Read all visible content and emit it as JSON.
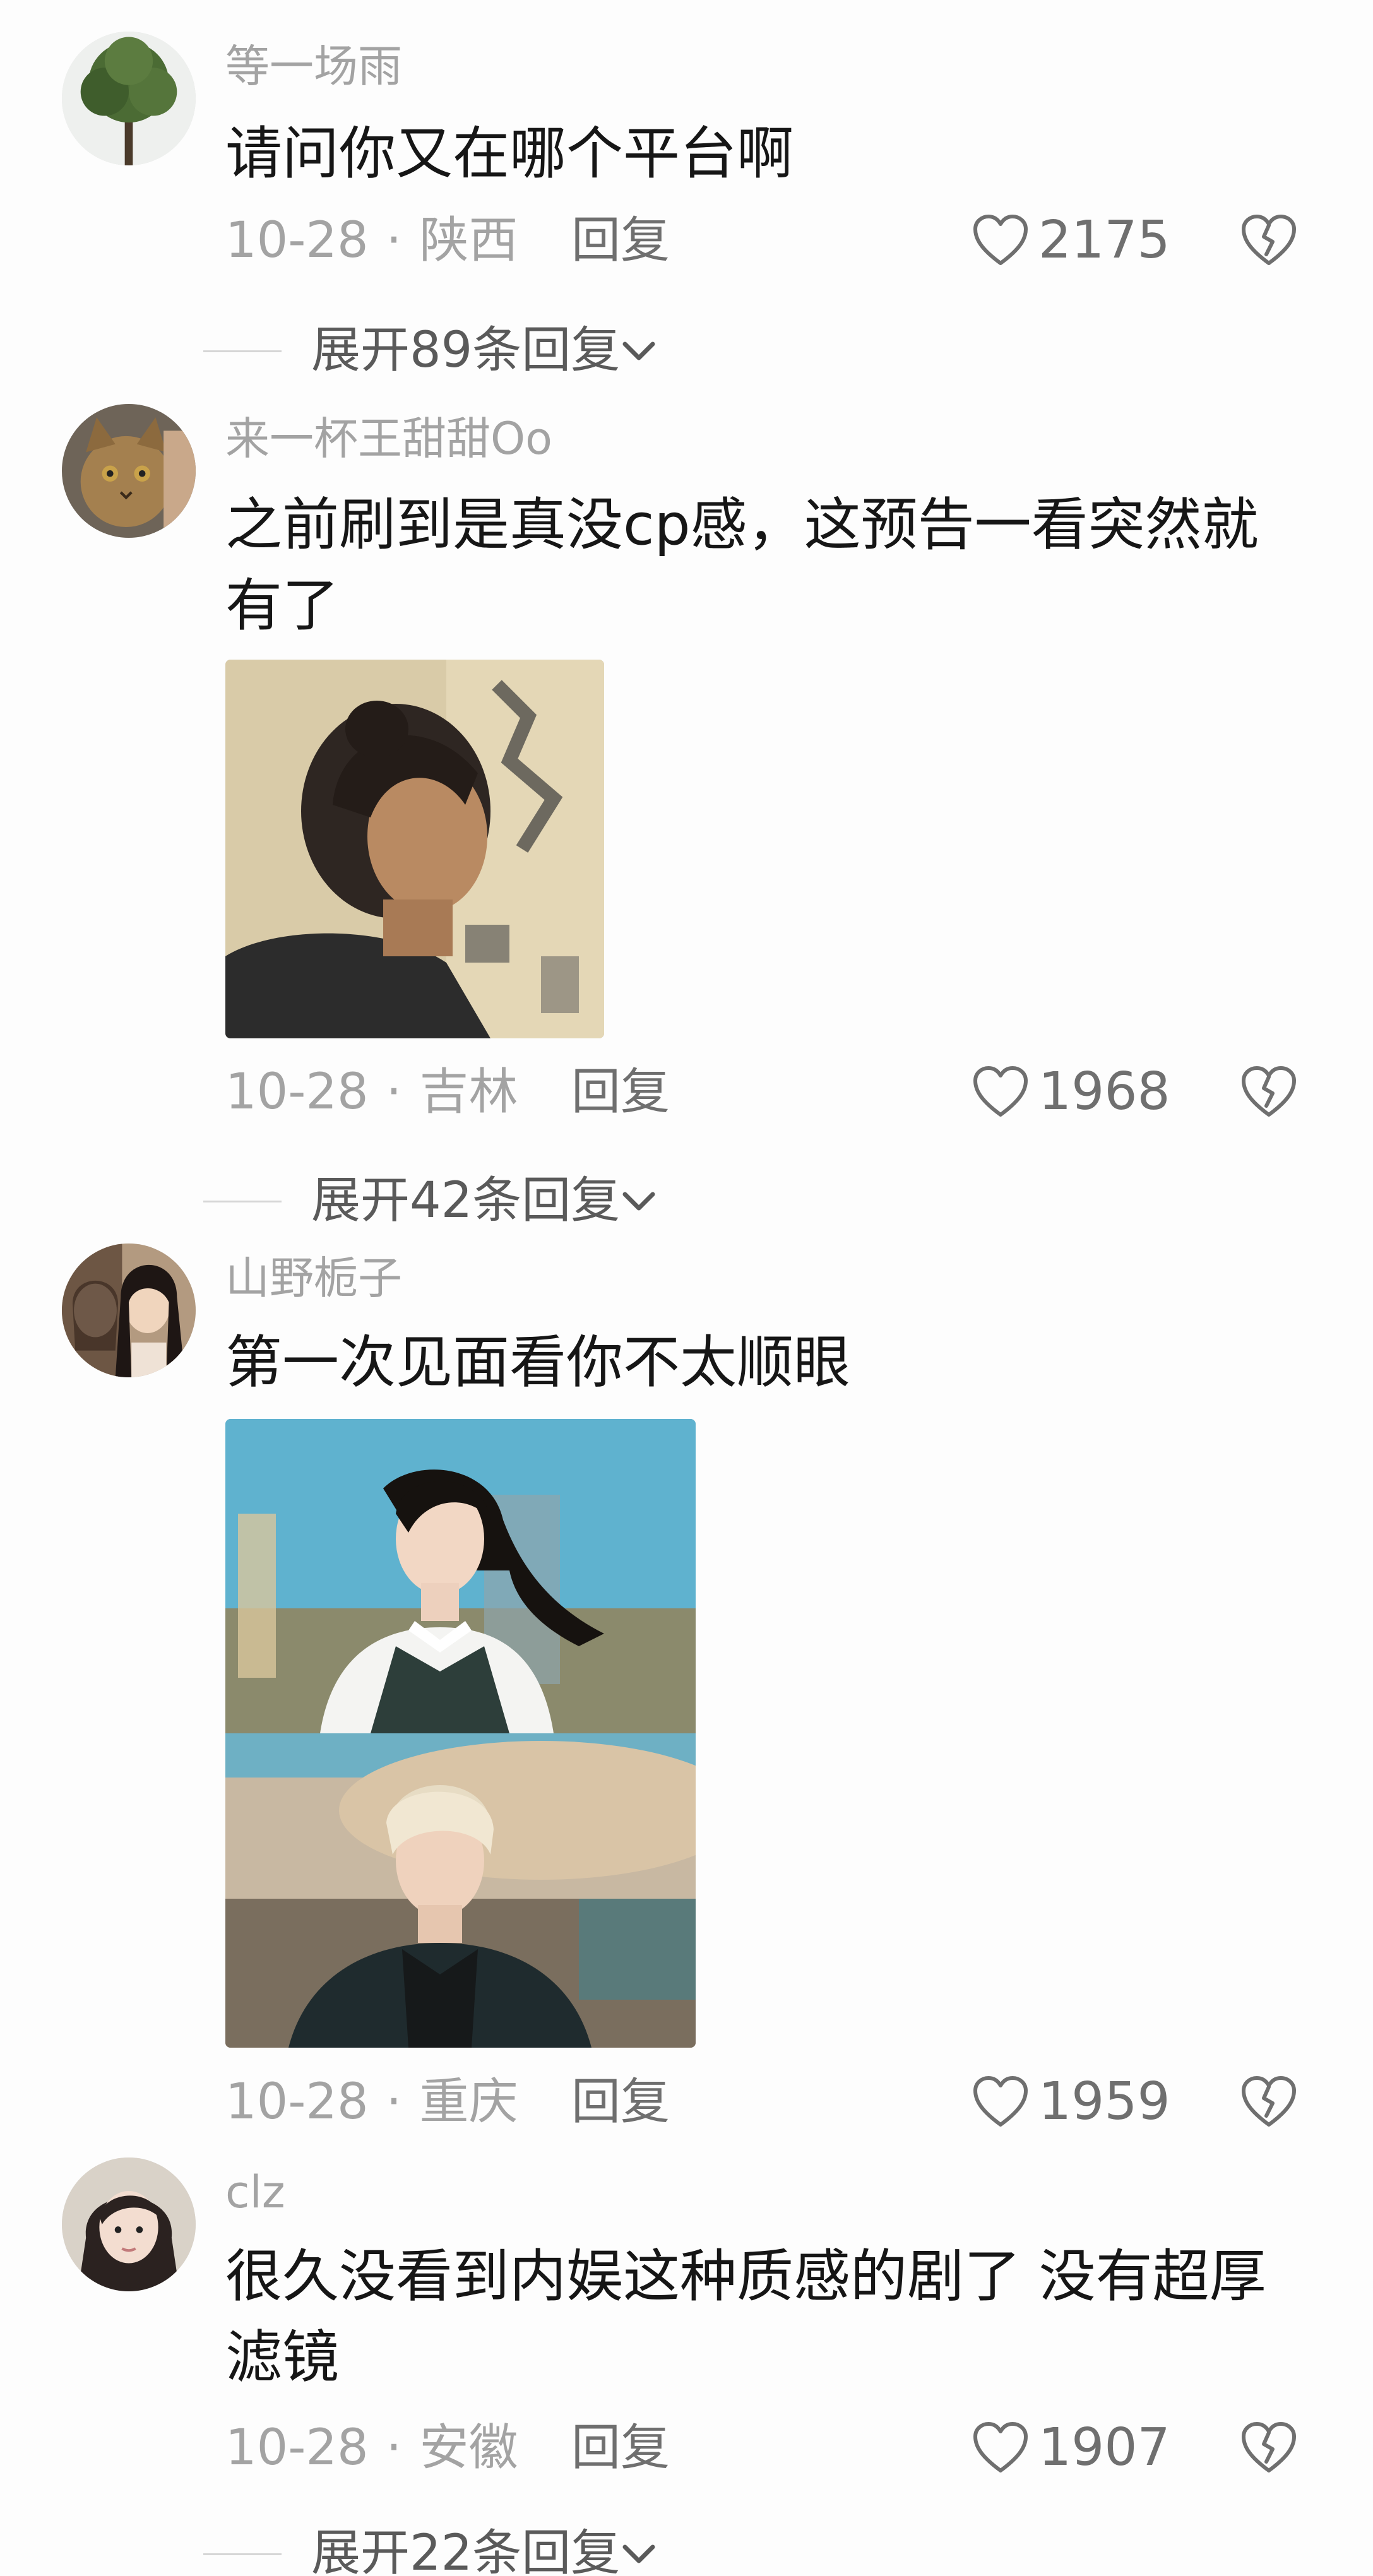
{
  "comments": [
    {
      "username": "等一场雨",
      "text": "请问你又在哪个平台啊",
      "date": "10-28",
      "location": "陕西",
      "reply_label": "回复",
      "likes": "2175",
      "avatar_icon": "tree-avatar",
      "expand_label": "展开89条回复"
    },
    {
      "username": "来一杯王甜甜Oo",
      "text": "之前刷到是真没cp感，这预告一看突然就有了",
      "date": "10-28",
      "location": "吉林",
      "reply_label": "回复",
      "likes": "1968",
      "avatar_icon": "cat-avatar",
      "expand_label": "展开42条回复"
    },
    {
      "username": "山野栀子",
      "text": "第一次见面看你不太顺眼",
      "date": "10-28",
      "location": "重庆",
      "reply_label": "回复",
      "likes": "1959",
      "avatar_icon": "two-women-avatar"
    },
    {
      "username": "clz",
      "text": "很久没看到内娱这种质感的剧了 没有超厚滤镜",
      "date": "10-28",
      "location": "安徽",
      "reply_label": "回复",
      "likes": "1907",
      "avatar_icon": "girl-avatar",
      "expand_label": "展开22条回复"
    }
  ],
  "colors": {
    "background": "#fdfdfd",
    "text": "#161616",
    "secondary": "#a3a3a3",
    "action": "#6f6f6f"
  }
}
